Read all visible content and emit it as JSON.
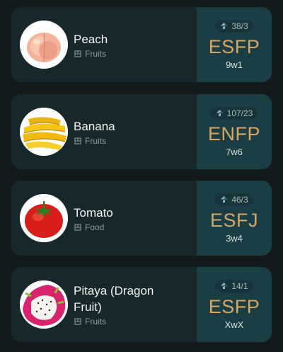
{
  "items": [
    {
      "name": "Peach",
      "category": "Fruits",
      "votes": "38/3",
      "type": "ESFP",
      "enneagram": "9w1",
      "icon": "peach-icon"
    },
    {
      "name": "Banana",
      "category": "Fruits",
      "votes": "107/23",
      "type": "ENFP",
      "enneagram": "7w6",
      "icon": "banana-icon"
    },
    {
      "name": "Tomato",
      "category": "Food",
      "votes": "46/3",
      "type": "ESFJ",
      "enneagram": "3w4",
      "icon": "tomato-icon"
    },
    {
      "name": "Pitaya (Dragon Fruit)",
      "category": "Fruits",
      "votes": "14/1",
      "type": "ESFP",
      "enneagram": "XwX",
      "icon": "pitaya-icon"
    }
  ],
  "colors": {
    "background": "#121a1b",
    "card": "#17282c",
    "side_panel": "#1b3e45",
    "type_text": "#d3a763"
  }
}
